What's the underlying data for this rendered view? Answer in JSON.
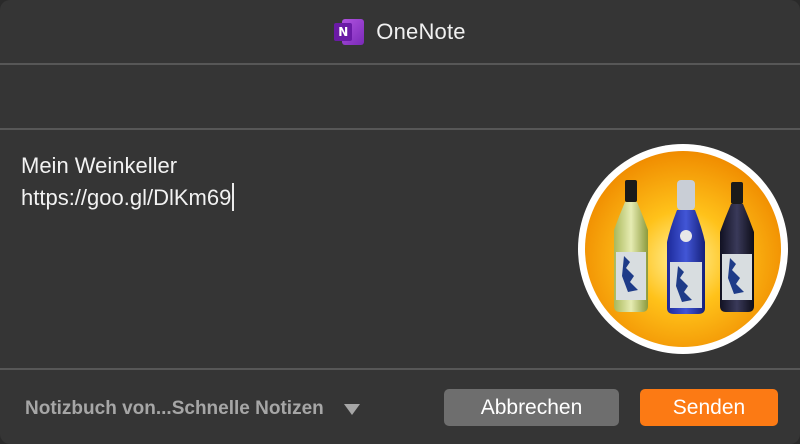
{
  "window": {
    "title": "OneNote",
    "app_icon": "onenote-icon",
    "app_icon_letter": "N"
  },
  "note": {
    "line1": "Mein Weinkeller",
    "line2": "https://goo.gl/DlKm69"
  },
  "thumbnail": {
    "icon": "wine-bottles-image",
    "colors": {
      "gold": "#f5a800",
      "outer": "#ffffff"
    }
  },
  "footer": {
    "notebook_location": "Notizbuch von...Schnelle Notizen",
    "cancel_label": "Abbrechen",
    "send_label": "Senden"
  },
  "colors": {
    "background": "#353535",
    "divider": "#575757",
    "accent": "#fc7a14",
    "cancel_button": "#6e6e6e"
  }
}
